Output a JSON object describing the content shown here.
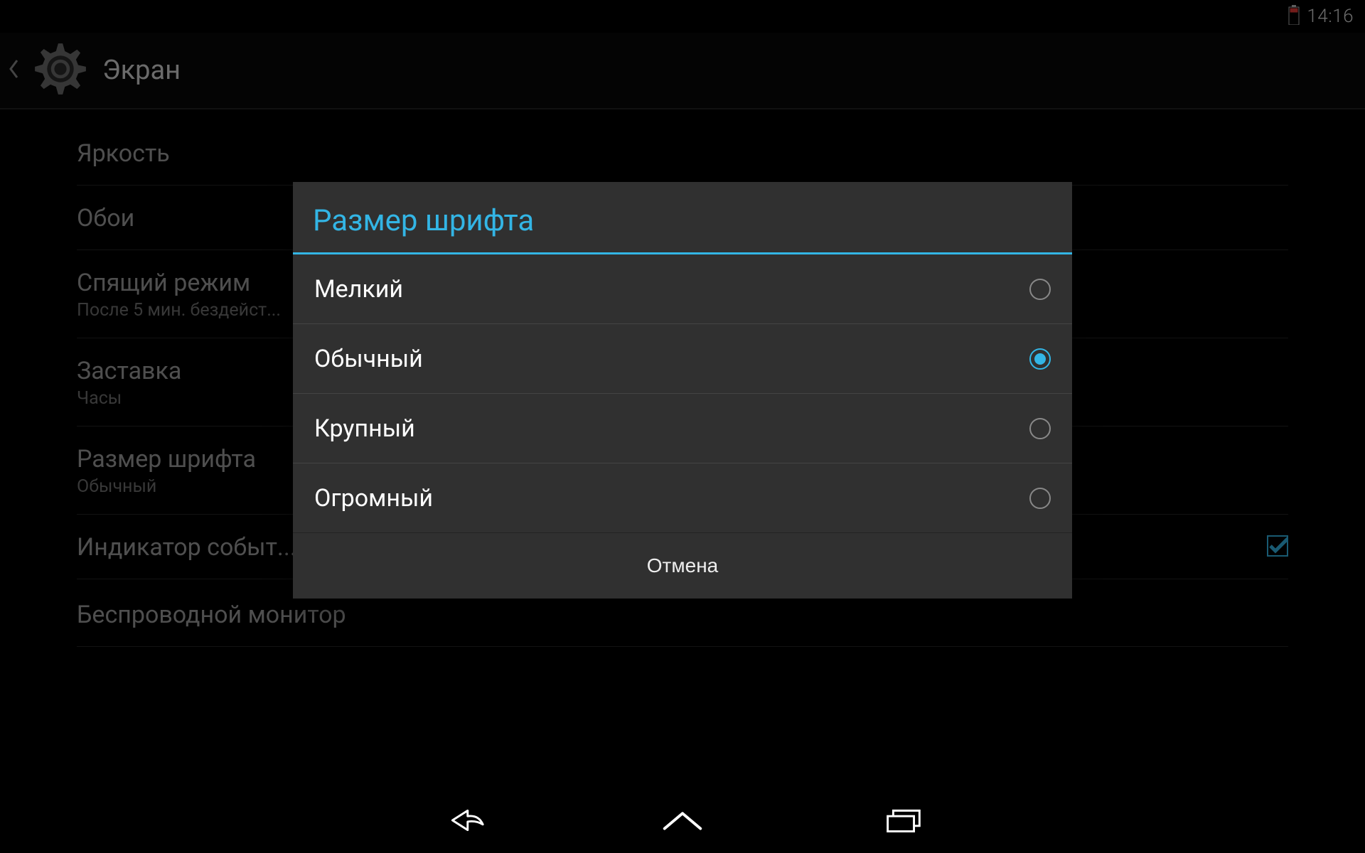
{
  "status_bar": {
    "time": "14:16"
  },
  "action_bar": {
    "title": "Экран"
  },
  "settings": {
    "items": [
      {
        "title": "Яркость",
        "sub": ""
      },
      {
        "title": "Обои",
        "sub": ""
      },
      {
        "title": "Спящий режим",
        "sub": "После 5 мин. бездейст..."
      },
      {
        "title": "Заставка",
        "sub": "Часы"
      },
      {
        "title": "Размер шрифта",
        "sub": "Обычный"
      },
      {
        "title": "Индикатор событ...",
        "sub": "",
        "checked": true
      },
      {
        "title": "Беспроводной монитор",
        "sub": ""
      }
    ]
  },
  "dialog": {
    "title": "Размер шрифта",
    "options": [
      {
        "label": "Мелкий",
        "selected": false
      },
      {
        "label": "Обычный",
        "selected": true
      },
      {
        "label": "Крупный",
        "selected": false
      },
      {
        "label": "Огромный",
        "selected": false
      }
    ],
    "cancel_label": "Отмена"
  }
}
